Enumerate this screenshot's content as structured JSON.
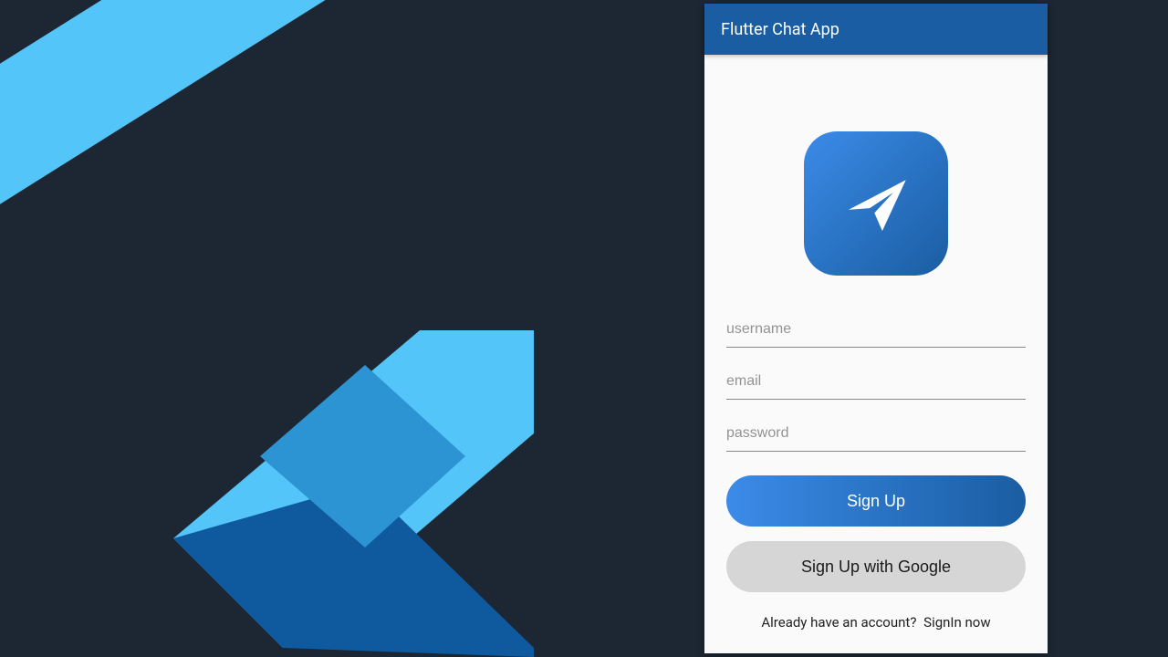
{
  "appbar": {
    "title": "Flutter Chat App"
  },
  "form": {
    "username_placeholder": "username",
    "email_placeholder": "email",
    "password_placeholder": "password",
    "signup_label": "Sign Up",
    "google_signup_label": "Sign Up with Google"
  },
  "footer": {
    "prompt": "Already have an account?",
    "link": "SignIn now"
  },
  "icons": {
    "app_logo": "paper-plane-icon"
  },
  "colors": {
    "primary": "#1a5da2",
    "accent": "#3b8be8",
    "background_dark": "#1c2733",
    "button_secondary_bg": "#d6d6d6"
  }
}
